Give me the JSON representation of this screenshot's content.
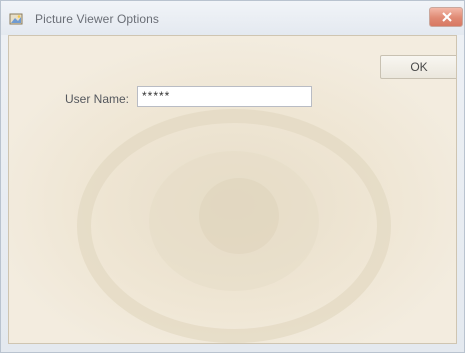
{
  "window": {
    "title": "Picture Viewer Options",
    "icon": "picture-app-icon",
    "close_icon": "close-icon"
  },
  "form": {
    "user_name_label": "User Name:",
    "user_name_value": "*****",
    "ok_label": "OK"
  },
  "colors": {
    "client_background": "#efe7d6",
    "close_button": "#e08a74",
    "titlebar": "#e9edf2"
  }
}
